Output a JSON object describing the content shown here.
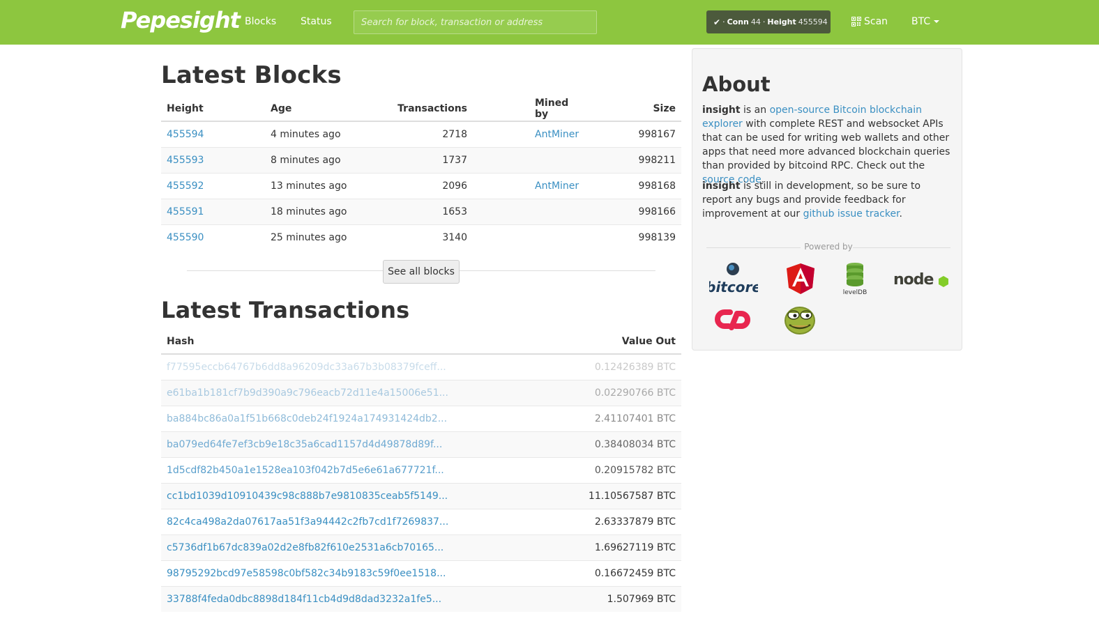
{
  "navbar": {
    "brand": "Pepesight",
    "blocks_link": "Blocks",
    "status_link": "Status",
    "search_placeholder": "Search for block, transaction or address",
    "conn_label": "Conn",
    "conn_value": "44",
    "height_label": "Height",
    "height_value": "455594",
    "scan_label": "Scan",
    "currency": "BTC"
  },
  "latest_blocks": {
    "title": "Latest Blocks",
    "columns": [
      "Height",
      "Age",
      "Transactions",
      "Mined by",
      "Size"
    ],
    "rows": [
      {
        "height": "455594",
        "age": "4 minutes ago",
        "transactions": "2718",
        "mined_by": "AntMiner",
        "size": "998167"
      },
      {
        "height": "455593",
        "age": "8 minutes ago",
        "transactions": "1737",
        "mined_by": "",
        "size": "998211"
      },
      {
        "height": "455592",
        "age": "13 minutes ago",
        "transactions": "2096",
        "mined_by": "AntMiner",
        "size": "998168"
      },
      {
        "height": "455591",
        "age": "18 minutes ago",
        "transactions": "1653",
        "mined_by": "",
        "size": "998166"
      },
      {
        "height": "455590",
        "age": "25 minutes ago",
        "transactions": "3140",
        "mined_by": "",
        "size": "998139"
      }
    ],
    "see_all_label": "See all blocks"
  },
  "latest_transactions": {
    "title": "Latest Transactions",
    "columns": [
      "Hash",
      "Value Out"
    ],
    "rows": [
      {
        "hash": "f77595eccb64767b6dd8a96209dc33a67b3b08379fceff...",
        "value": "0.12426389 BTC"
      },
      {
        "hash": "e61ba1b181cf7b9d390a9c796eacb72d11e4a15006e51...",
        "value": "0.02290766 BTC"
      },
      {
        "hash": "ba884bc86a0a1f51b668c0deb24f1924a174931424db2...",
        "value": "2.41107401 BTC"
      },
      {
        "hash": "ba079ed64fe7ef3cb9e18c35a6cad1157d4d49878d89f...",
        "value": "0.38408034 BTC"
      },
      {
        "hash": "1d5cdf82b450a1e1528ea103f042b7d5e6e61a677721f...",
        "value": "0.20915782 BTC"
      },
      {
        "hash": "cc1bd1039d10910439c98c888b7e9810835ceab5f5149...",
        "value": "11.10567587 BTC"
      },
      {
        "hash": "82c4ca498a2da07617aa51f3a94442c2fb7cd1f7269837...",
        "value": "2.63337879 BTC"
      },
      {
        "hash": "c5736df1b67dc839a02d2e8fb82f610e2531a6cb70165...",
        "value": "1.69627119 BTC"
      },
      {
        "hash": "98795292bcd97e58598c0bf582c34b9183c59f0ee1518...",
        "value": "0.16672459 BTC"
      },
      {
        "hash": "33788f4feda0dbc8898d184f11cb4d9d8dad3232a1fe5...",
        "value": "1.507969 BTC"
      }
    ]
  },
  "about": {
    "title": "About",
    "p1_bold": "insight",
    "p1_pre": " is an ",
    "p1_link": "open-source Bitcoin blockchain explorer",
    "p1_mid": " with complete REST and websocket APIs that can be used for writing web wallets and other apps that need more advanced blockchain queries than provided by bitcoind RPC. Check out the ",
    "p1_link2": "source code",
    "p1_end": ".",
    "p2_bold": "insight",
    "p2_mid": " is still in development, so be sure to report any bugs and provide feedback for improvement at our ",
    "p2_link": "github issue tracker",
    "p2_end": ".",
    "powered_by": "Powered by",
    "logos": [
      "bitcore-logo",
      "angular-logo",
      "leveldb-logo",
      "node-logo",
      "copay-logo",
      "pepe-logo"
    ],
    "logo_text": {
      "bitcore": "bitcore",
      "leveldb": "levelDB",
      "node": "node"
    }
  },
  "colors": {
    "navbar": "#8dc63f",
    "link": "#3a8fc2",
    "badge": "#4c5a3c"
  }
}
